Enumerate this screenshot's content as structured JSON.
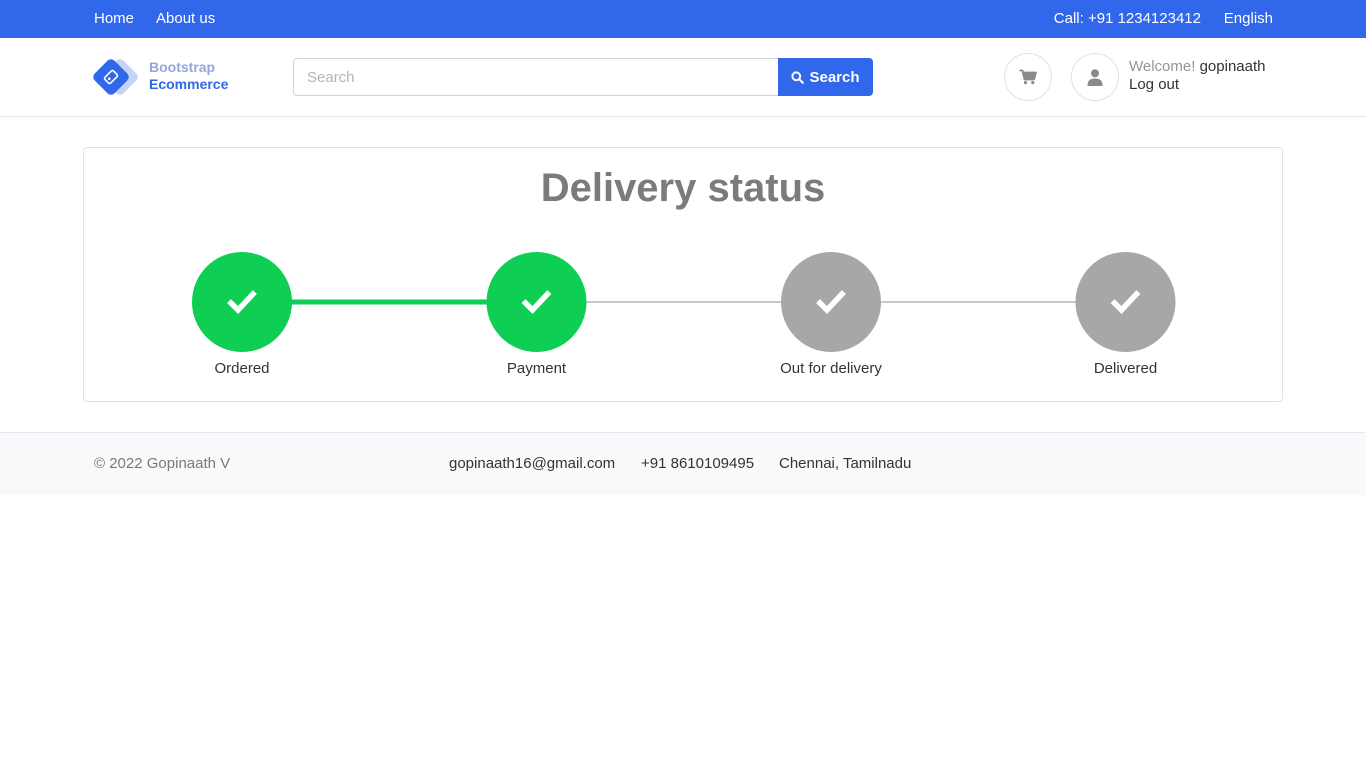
{
  "topbar": {
    "home": "Home",
    "about": "About us",
    "call": "Call: +91 1234123412",
    "language": "English"
  },
  "logo": {
    "line1": "Bootstrap",
    "line2": "Ecommerce"
  },
  "search": {
    "placeholder": "Search",
    "value": "",
    "button_label": "Search"
  },
  "account": {
    "welcome": "Welcome!",
    "username": "gopinaath",
    "logout": "Log out"
  },
  "delivery": {
    "title": "Delivery status",
    "steps": [
      {
        "label": "Ordered",
        "complete": true
      },
      {
        "label": "Payment",
        "complete": true
      },
      {
        "label": "Out for delivery",
        "complete": false
      },
      {
        "label": "Delivered",
        "complete": false
      }
    ],
    "colors": {
      "complete": "#0ecf53",
      "incomplete": "#a7a7a7",
      "connector_incomplete": "#c8c8c8"
    }
  },
  "footer": {
    "copyright": "© 2022 Gopinaath V",
    "email": "gopinaath16@gmail.com",
    "phone": "+91 8610109495",
    "location": "Chennai, Tamilnadu"
  },
  "theme": {
    "primary": "#3167eb"
  }
}
